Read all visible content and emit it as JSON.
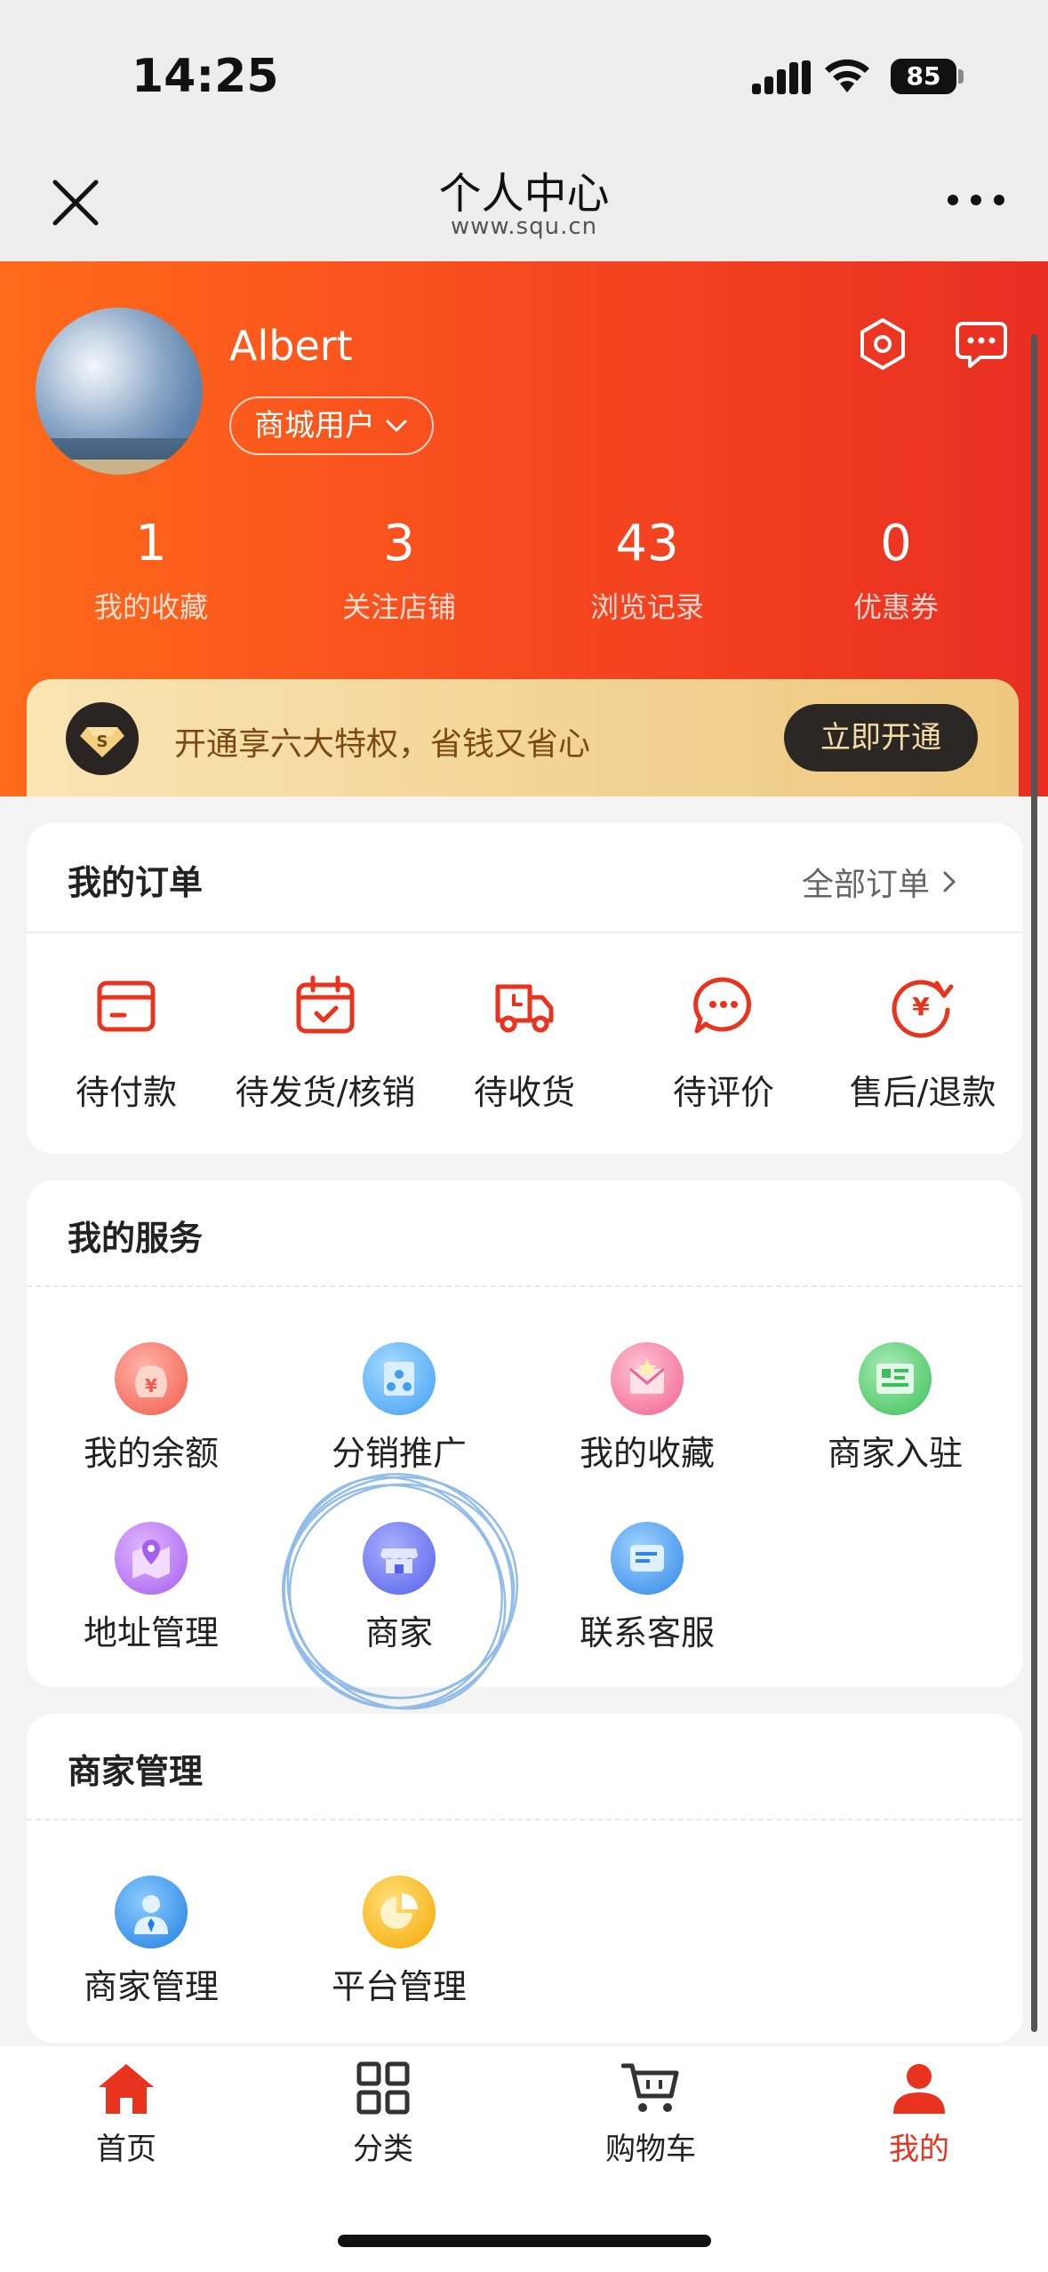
{
  "status_bar": {
    "time": "14:25",
    "battery": "85"
  },
  "nav": {
    "title": "个人中心",
    "subtitle": "www.squ.cn"
  },
  "profile": {
    "name": "Albert",
    "role": "商城用户"
  },
  "stats": [
    {
      "value": "1",
      "label": "我的收藏"
    },
    {
      "value": "3",
      "label": "关注店铺"
    },
    {
      "value": "43",
      "label": "浏览记录"
    },
    {
      "value": "0",
      "label": "优惠券"
    }
  ],
  "vip": {
    "text": "开通享六大特权，省钱又省心",
    "button": "立即开通"
  },
  "orders": {
    "title": "我的订单",
    "all_label": "全部订单",
    "items": [
      {
        "label": "待付款",
        "icon": "wallet-icon"
      },
      {
        "label": "待发货/核销",
        "icon": "calendar-check-icon"
      },
      {
        "label": "待收货",
        "icon": "truck-icon"
      },
      {
        "label": "待评价",
        "icon": "chat-bubble-icon"
      },
      {
        "label": "售后/退款",
        "icon": "refund-icon"
      }
    ]
  },
  "services": {
    "title": "我的服务",
    "items": [
      {
        "label": "我的余额",
        "icon": "money-bag-icon"
      },
      {
        "label": "分销推广",
        "icon": "distribution-icon"
      },
      {
        "label": "我的收藏",
        "icon": "favorites-envelope-icon"
      },
      {
        "label": "商家入驻",
        "icon": "merchant-join-icon"
      },
      {
        "label": "地址管理",
        "icon": "map-pin-icon"
      },
      {
        "label": "商家",
        "icon": "store-icon"
      },
      {
        "label": "联系客服",
        "icon": "customer-service-icon"
      }
    ]
  },
  "merchant": {
    "title": "商家管理",
    "items": [
      {
        "label": "商家管理",
        "icon": "merchant-user-icon"
      },
      {
        "label": "平台管理",
        "icon": "pie-chart-icon"
      }
    ]
  },
  "tabbar": [
    {
      "label": "首页",
      "icon": "home-icon"
    },
    {
      "label": "分类",
      "icon": "grid-icon"
    },
    {
      "label": "购物车",
      "icon": "cart-icon"
    },
    {
      "label": "我的",
      "icon": "user-icon",
      "active": true
    }
  ],
  "colors": {
    "accent": "#e8331e",
    "header_start": "#ff6a1a",
    "header_end": "#e82e22",
    "vip_gold": "#f2d292"
  }
}
